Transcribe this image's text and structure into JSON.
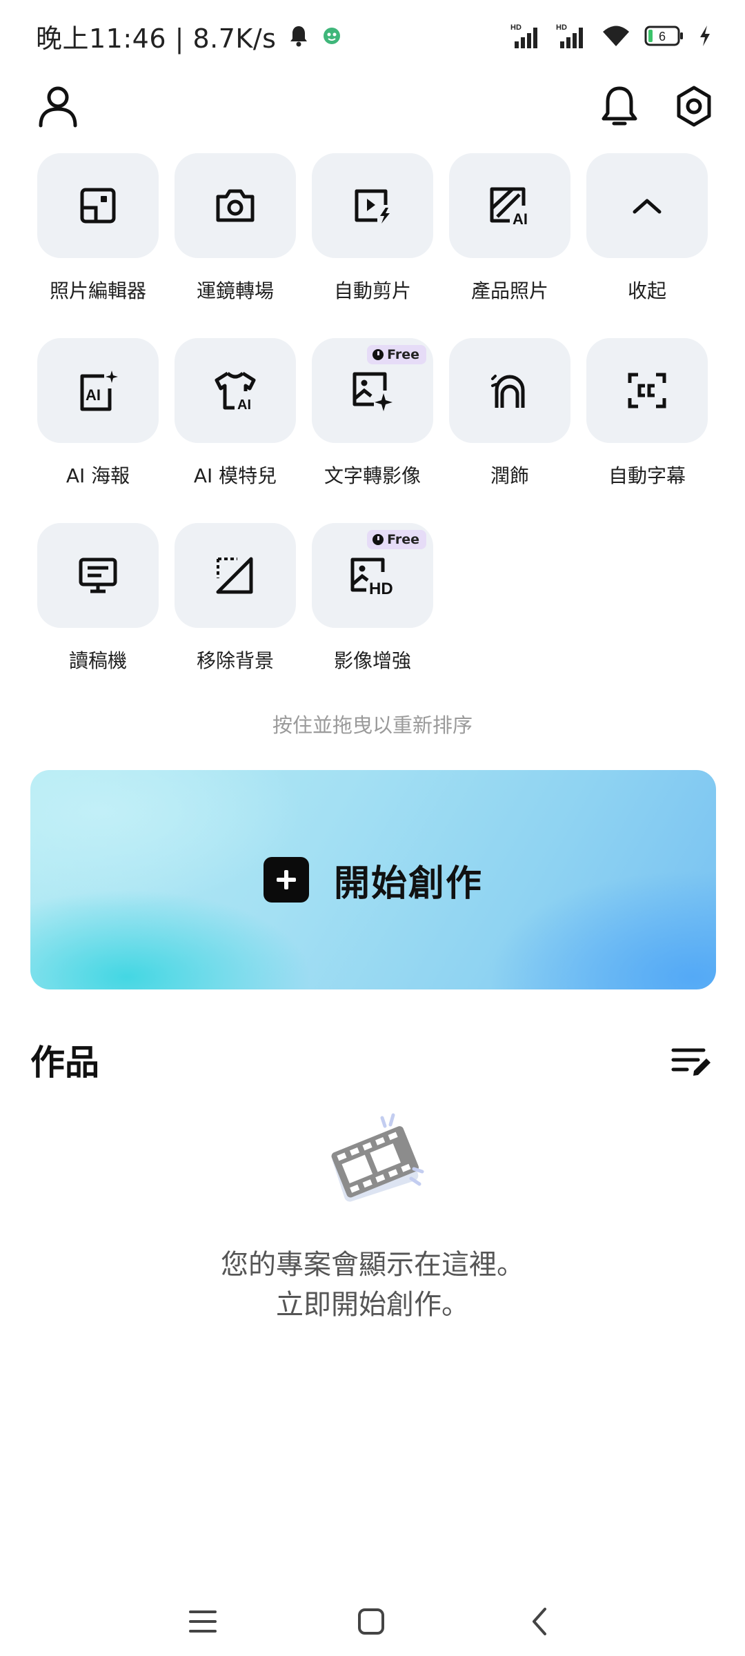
{
  "status_bar": {
    "time_speed": "晚上11:46 | 8.7K/s",
    "battery_level": "6",
    "network_labels": [
      "HD",
      "HD"
    ]
  },
  "tools": [
    {
      "label": "照片編輯器",
      "icon": "photo-editor-icon",
      "free": false
    },
    {
      "label": "運鏡轉場",
      "icon": "camera-icon",
      "free": false
    },
    {
      "label": "自動剪片",
      "icon": "auto-cut-icon",
      "free": false
    },
    {
      "label": "產品照片",
      "icon": "product-photo-ai-icon",
      "free": false
    },
    {
      "label": "收起",
      "icon": "chevron-up-icon",
      "free": false
    },
    {
      "label": "AI 海報",
      "icon": "ai-poster-icon",
      "free": false
    },
    {
      "label": "AI 模特兒",
      "icon": "ai-model-shirt-icon",
      "free": false
    },
    {
      "label": "文字轉影像",
      "icon": "text-to-image-icon",
      "free": true
    },
    {
      "label": "潤飾",
      "icon": "retouch-icon",
      "free": false
    },
    {
      "label": "自動字幕",
      "icon": "auto-captions-icon",
      "free": false
    },
    {
      "label": "讀稿機",
      "icon": "teleprompter-icon",
      "free": false
    },
    {
      "label": "移除背景",
      "icon": "remove-background-icon",
      "free": false
    },
    {
      "label": "影像增強",
      "icon": "image-enhance-hd-icon",
      "free": true
    }
  ],
  "free_badge_label": "Free",
  "reorder_hint": "按住並拖曳以重新排序",
  "create_button_label": "開始創作",
  "works": {
    "title": "作品",
    "empty_line1": "您的專案會顯示在這裡。",
    "empty_line2": "立即開始創作。"
  },
  "colors": {
    "tile_bg": "#eef1f5",
    "free_badge_bg": "#e6dcf7",
    "banner_start": "#b6ecf4",
    "banner_end": "#76c0f2"
  }
}
